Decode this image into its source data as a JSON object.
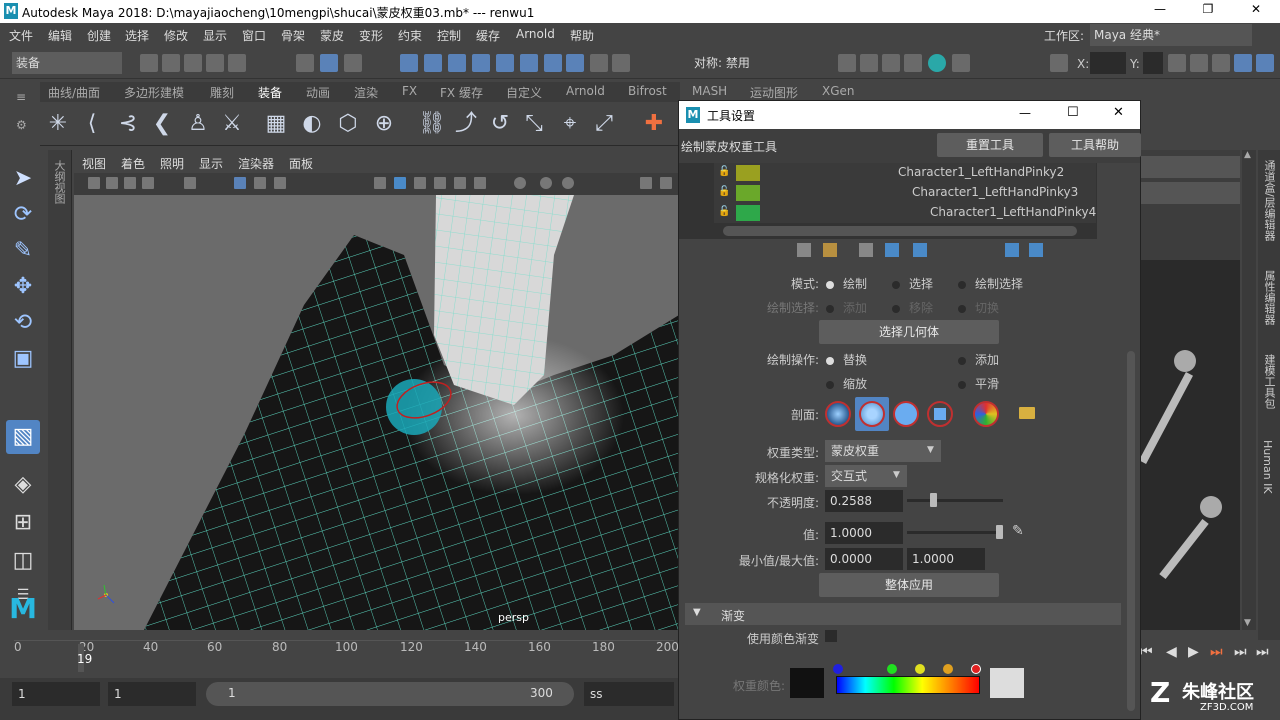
{
  "title_bar": {
    "title": "Autodesk Maya 2018: D:\\mayajiaocheng\\10mengpi\\shucai\\蒙皮权重03.mb*   ---   renwu1",
    "app_icon": "maya-icon"
  },
  "menu": [
    "文件",
    "编辑",
    "创建",
    "选择",
    "修改",
    "显示",
    "窗口",
    "骨架",
    "蒙皮",
    "变形",
    "约束",
    "控制",
    "缓存",
    "Arnold",
    "帮助"
  ],
  "workspace": {
    "label": "工作区:",
    "value": "Maya 经典*"
  },
  "status_line": {
    "menuset": "装备",
    "symmetry": "对称: 禁用",
    "x_label": "X:",
    "y_label": "Y:"
  },
  "shelf_tabs": [
    "曲线/曲面",
    "多边形建模",
    "雕刻",
    "装备",
    "动画",
    "渲染",
    "FX",
    "FX 缓存",
    "自定义",
    "Arnold",
    "Bifrost",
    "MASH",
    "运动图形",
    "XGen"
  ],
  "panel_menu": [
    "视图",
    "着色",
    "照明",
    "显示",
    "渲染器",
    "面板"
  ],
  "viewport": {
    "camera": "persp",
    "outliner_tab": "大纲视图"
  },
  "time_slider": {
    "ticks": [
      "0",
      "20",
      "40",
      "60",
      "80",
      "100",
      "120",
      "140",
      "160",
      "180",
      "200"
    ],
    "current_frame": "19"
  },
  "range_slider": {
    "start": "1",
    "start2": "1",
    "range_start": "1",
    "range_end": "300",
    "end_field": "ss"
  },
  "dialog": {
    "title": "工具设置",
    "tool_name": "绘制蒙皮权重工具",
    "reset_button": "重置工具",
    "help_button": "工具帮助",
    "joints": [
      {
        "name": "Character1_LeftHandPinky2",
        "color": "#9aa020"
      },
      {
        "name": "Character1_LeftHandPinky3",
        "color": "#6aa82a"
      },
      {
        "name": "Character1_LeftHandPinky4",
        "color": "#2ea84a"
      }
    ],
    "mode": {
      "label": "模式:",
      "options": [
        "绘制",
        "选择",
        "绘制选择"
      ]
    },
    "paint_select": {
      "label": "绘制选择:",
      "options": [
        "添加",
        "移除",
        "切换"
      ]
    },
    "select_geometry": "选择几何体",
    "paint_operation": {
      "label": "绘制操作:",
      "options": [
        "替换",
        "添加",
        "缩放",
        "平滑"
      ]
    },
    "profile_label": "剖面:",
    "weight_type": {
      "label": "权重类型:",
      "value": "蒙皮权重"
    },
    "normalize": {
      "label": "规格化权重:",
      "value": "交互式"
    },
    "opacity": {
      "label": "不透明度:",
      "value": "0.2588",
      "level": 0.2588
    },
    "value": {
      "label": "值:",
      "value": "1.0000",
      "level": 1.0
    },
    "minmax": {
      "label": "最小值/最大值:",
      "min": "0.0000",
      "max": "1.0000"
    },
    "flood": "整体应用",
    "gradient_section": "渐变",
    "use_color_ramp": "使用颜色渐变",
    "weight_color": "权重颜色:"
  },
  "side_tabs": [
    "通道盒/层编辑器",
    "属性编辑器",
    "建模工具包",
    "Human IK"
  ],
  "watermark": {
    "text": "朱峰社区",
    "sub": "ZF3D.COM"
  }
}
